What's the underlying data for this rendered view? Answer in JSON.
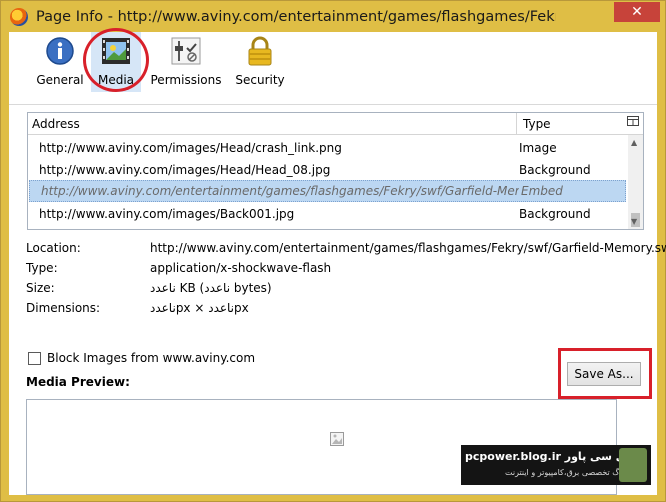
{
  "window": {
    "title": "Page Info - http://www.aviny.com/entertainment/games/flashgames/Fekry/pa...",
    "close_glyph": "✕"
  },
  "toolbar": {
    "general": "General",
    "media": "Media",
    "permissions": "Permissions",
    "security": "Security"
  },
  "media_table": {
    "headers": {
      "address": "Address",
      "type": "Type"
    },
    "rows": [
      {
        "address": "http://www.aviny.com/images/Head/crash_link.png",
        "type": "Image"
      },
      {
        "address": "http://www.aviny.com/images/Head/Head_08.jpg",
        "type": "Background"
      },
      {
        "address": "http://www.aviny.com/entertainment/games/flashgames/Fekry/swf/Garfield-Memory.swf",
        "type": "Embed"
      },
      {
        "address": "http://www.aviny.com/images/Back001.jpg",
        "type": "Background"
      }
    ]
  },
  "properties": {
    "location_label": "Location:",
    "location_value": "http://www.aviny.com/entertainment/games/flashgames/Fekry/swf/Garfield-Memory.swf",
    "type_label": "Type:",
    "type_value": "application/x-shockwave-flash",
    "size_label": "Size:",
    "size_value": "ناعدد KB (ناعدد bytes)",
    "dimensions_label": "Dimensions:",
    "dimensions_value": "ناعددpx × ناعددpx"
  },
  "block_images": {
    "label": "Block Images from www.aviny.com",
    "checked": false
  },
  "save_as": "Save As...",
  "preview_label": "Media Preview:",
  "watermark": {
    "title": "pcpower.blog.ir  پی سی پاور",
    "subtitle": "وبلاگ تخصصی برق،کامپیوتر و اینترنت"
  }
}
